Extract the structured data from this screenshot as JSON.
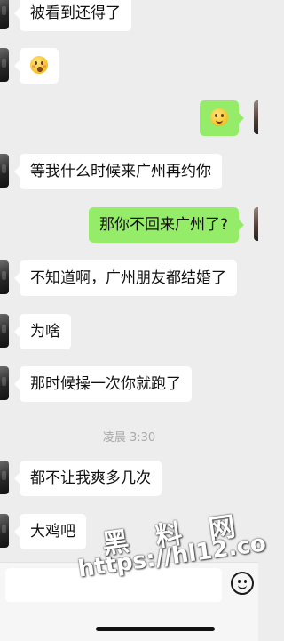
{
  "messages": [
    {
      "side": "in",
      "text": "被看到还得了"
    },
    {
      "side": "in",
      "emoji": "flushed-face-emoji"
    },
    {
      "side": "out",
      "emoji": "smiling-face-emoji"
    },
    {
      "side": "in",
      "text": "等我什么时候来广州再约你"
    },
    {
      "side": "out",
      "text": "那你不回来广州了?"
    },
    {
      "side": "in",
      "text": "不知道啊，广州朋友都结婚了"
    },
    {
      "side": "in",
      "text": "为啥"
    },
    {
      "side": "in",
      "text": "那时候操一次你就跑了"
    },
    {
      "side": "in",
      "text": "都不让我爽多几次"
    },
    {
      "side": "in",
      "text": "大鸡吧"
    }
  ],
  "timestamp": "凌晨 3:30",
  "input": {
    "value": "",
    "emoji_button_icon": "smiley-face-icon"
  },
  "watermark": {
    "line1": "黑 料 网",
    "line2": "https://hl12.co"
  },
  "colors": {
    "background": "#ededed",
    "incoming_bubble": "#ffffff",
    "outgoing_bubble": "#95ec69",
    "timestamp_text": "#a9a9a9"
  }
}
